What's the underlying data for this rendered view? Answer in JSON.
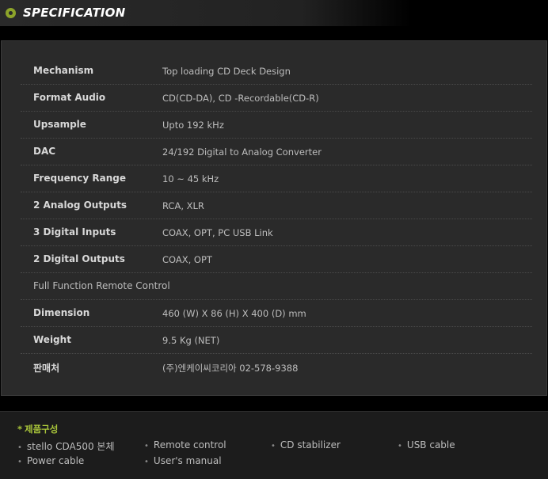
{
  "header": {
    "title": "SPECIFICATION"
  },
  "spec": {
    "rows": [
      {
        "label": "Mechanism",
        "value": "Top loading CD Deck Design"
      },
      {
        "label": "Format Audio",
        "value": "CD(CD-DA), CD -Recordable(CD-R)"
      },
      {
        "label": "Upsample",
        "value": "Upto 192 kHz"
      },
      {
        "label": "DAC",
        "value": "24/192 Digital to Analog Converter"
      },
      {
        "label": "Frequency Range",
        "value": "10 ~ 45 kHz"
      },
      {
        "label": "2 Analog Outputs",
        "value": "RCA, XLR"
      },
      {
        "label": "3 Digital Inputs",
        "value": "COAX, OPT, PC USB Link"
      },
      {
        "label": "2 Digital Outputs",
        "value": "COAX, OPT"
      },
      {
        "label": "Full Function Remote Control",
        "value": ""
      },
      {
        "label": "Dimension",
        "value": "460 (W) X 86 (H) X 400 (D) mm"
      },
      {
        "label": "Weight",
        "value": "9.5 Kg (NET)"
      },
      {
        "label": "판매처",
        "value": "(주)엔케이씨코리아   02-578-9388"
      }
    ]
  },
  "components": {
    "heading": "제품구성",
    "items": [
      "stello CDA500 본체",
      "Remote control",
      "CD stabilizer",
      "USB cable",
      "Power cable",
      "User's manual"
    ]
  },
  "colors": {
    "accent": "#a8c43a",
    "panel": "#2a2a2a",
    "background": "#000000"
  }
}
